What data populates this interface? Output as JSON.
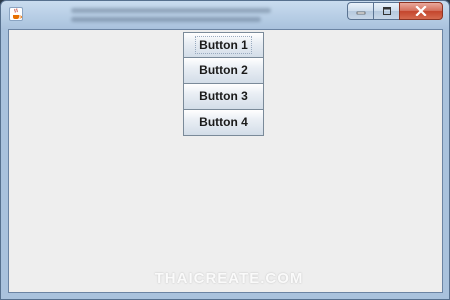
{
  "window": {
    "icon": "java-coffee-cup-icon",
    "title": "",
    "controls": {
      "minimize": "minimize-icon",
      "maximize": "maximize-icon",
      "close": "close-icon"
    }
  },
  "content": {
    "buttons": [
      {
        "label": "Button 1",
        "focused": true
      },
      {
        "label": "Button 2",
        "focused": false
      },
      {
        "label": "Button 3",
        "focused": false
      },
      {
        "label": "Button 4",
        "focused": false
      }
    ]
  },
  "watermark": "THAICREATE.COM",
  "colors": {
    "client_background": "#eeeeee",
    "close_button": "#c4452c",
    "frame": "#a9c2dd"
  }
}
